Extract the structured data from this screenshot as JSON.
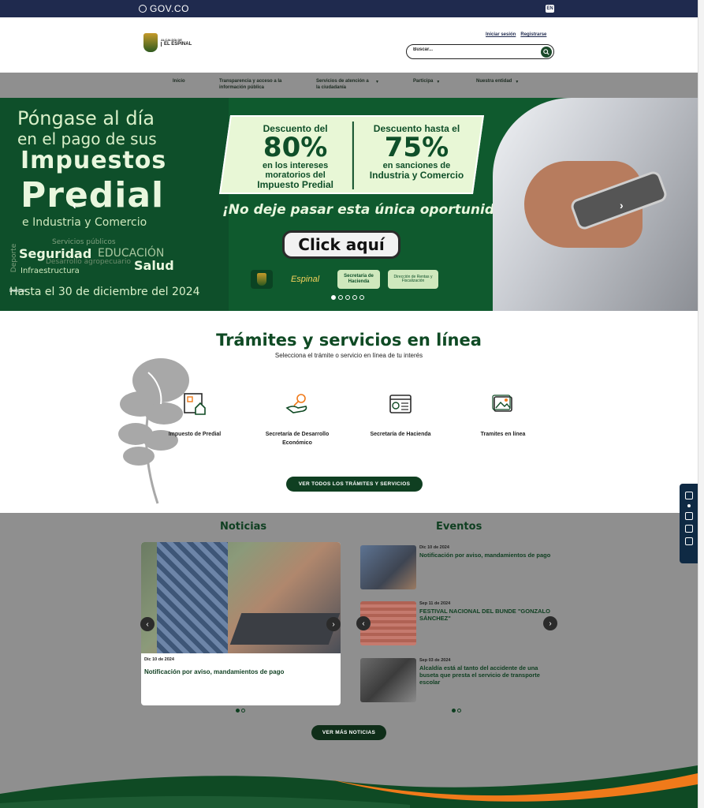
{
  "govbar": {
    "logo_text": "GOV.CO",
    "lang": "EN"
  },
  "header": {
    "brand_small": "ALCALDÍA DE",
    "brand_big": "EL ESPINAL",
    "login": "Iniciar sesión",
    "register": "Registrarse",
    "search_placeholder": "Buscar..."
  },
  "nav": {
    "items": [
      {
        "label": "Inicio"
      },
      {
        "label": "Transparencia y acceso a la información pública"
      },
      {
        "label": "Servicios de atención a la ciudadanía"
      },
      {
        "label": "Participa"
      },
      {
        "label": "Nuestra entidad"
      }
    ]
  },
  "hero": {
    "line1": "Póngase al día",
    "line2": "en el pago de sus",
    "line3": "Impuestos",
    "line4": "Predial",
    "line5": "e Industria y Comercio",
    "tags": {
      "servicios": "Servicios públicos",
      "seguridad": "Seguridad",
      "educacion": "EDUCACIÓN",
      "desarrollo": "Desarrollo agropecuario",
      "salud": "Salud",
      "infra": "Infraestructura",
      "deporte": "Deporte"
    },
    "date_text": "Hasta el 30 de diciembre del 2024",
    "promo_left": {
      "a": "Descuento del",
      "b": "80%",
      "c1": "en los intereses",
      "c2": "moratorios del",
      "c3": "Impuesto Predial"
    },
    "promo_right": {
      "a": "Descuento hasta el",
      "b": "75%",
      "c1": "en sanciones de",
      "c2": "Industria y Comercio"
    },
    "slogan": "¡No deje pasar esta única oportunidad!",
    "cta": "Click aquí",
    "logo_espinal": "Espinal",
    "logo_hacienda": "Secretaría de Hacienda",
    "logo_direccion": "Dirección de Rentas y Fiscalización",
    "pause_label": "Detener"
  },
  "tramites": {
    "title": "Trámites y servicios en línea",
    "subtitle": "Selecciona el trámite o servicio en línea de tu interés",
    "services": [
      {
        "label": "Impuesto de Predial"
      },
      {
        "label": "Secretaría de Desarrollo Económico"
      },
      {
        "label": "Secretaría de Hacienda"
      },
      {
        "label": "Tramites en línea"
      }
    ],
    "button": "VER TODOS LOS TRÁMITES Y SERVICIOS"
  },
  "news": {
    "title": "Noticias",
    "card_date": "Dic 10 de 2024",
    "card_title": "Notificación por aviso, mandamientos de pago",
    "button": "VER MÁS NOTICIAS"
  },
  "events": {
    "title": "Eventos",
    "items": [
      {
        "date": "Dic 10 de 2024",
        "title": "Notificación por aviso, mandamientos de pago"
      },
      {
        "date": "Sep 11 de 2024",
        "title": "FESTIVAL NACIONAL DEL BUNDE \"GONZALO SÁNCHEZ\""
      },
      {
        "date": "Sep 03 de 2024",
        "title": "Alcaldía está al tanto del accidente de una buseta que presta el servicio de transporte escolar"
      }
    ]
  },
  "colors": {
    "primary_green": "#0f3f21",
    "gov_blue": "#1f2a4e",
    "accent_orange": "#f07a1a"
  }
}
